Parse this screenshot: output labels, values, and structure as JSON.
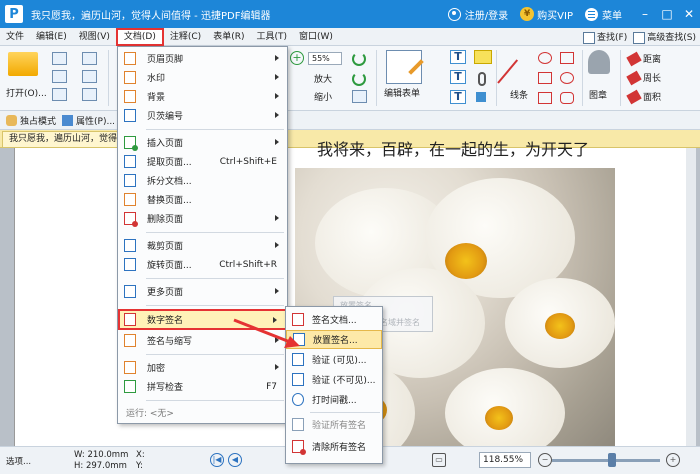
{
  "titlebar": {
    "title": "我只愿我，遍历山河，觉得人间值得",
    "app_name": "迅捷PDF编辑器",
    "login_label": "注册/登录",
    "vip_label": "购买VIP",
    "menu_label": "菜单"
  },
  "menubar": {
    "items": [
      "文件",
      "编辑(E)",
      "视图(V)",
      "文档(D)",
      "注释(C)",
      "表单(R)",
      "工具(T)",
      "窗口(W)"
    ],
    "find_label": "查找(F)",
    "advanced_find_label": "高级查找(S)"
  },
  "ribbon": {
    "open_label": "打开(O)...",
    "zoom_value": "55%",
    "zoom_in_label": "放大",
    "zoom_out_label": "缩小",
    "edit_form_label": "编辑表单",
    "line_label": "线条",
    "stamp_label": "图章",
    "measure_distance": "距离",
    "measure_perimeter": "周长",
    "measure_area": "面积"
  },
  "toolbar2": {
    "exclusive_mode": "独占模式",
    "properties": "属性(P)..."
  },
  "tab": {
    "doc_tab_label": "我只愿我，遍历山河，觉得人"
  },
  "document": {
    "visible_text": "我将来，百辟，在一起的生，为开天了"
  },
  "doc_menu": {
    "items": [
      {
        "label": "页眉页脚",
        "submenu": true
      },
      {
        "label": "水印",
        "submenu": true
      },
      {
        "label": "背景",
        "submenu": true
      },
      {
        "label": "贝茨编号",
        "submenu": true
      },
      {
        "label": "插入页面",
        "submenu": true
      },
      {
        "label": "提取页面...",
        "shortcut": "Ctrl+Shift+E"
      },
      {
        "label": "拆分文档..."
      },
      {
        "label": "替换页面..."
      },
      {
        "label": "删除页面",
        "submenu": true
      },
      {
        "label": "裁剪页面",
        "submenu": true
      },
      {
        "label": "旋转页面...",
        "shortcut": "Ctrl+Shift+R"
      },
      {
        "label": "更多页面",
        "submenu": true
      },
      {
        "label": "数字签名",
        "submenu": true
      },
      {
        "label": "签名与缩写",
        "submenu": true
      },
      {
        "label": "加密",
        "submenu": true
      },
      {
        "label": "拼写检查",
        "shortcut": "F7"
      },
      {
        "label": "运行: <无>"
      }
    ]
  },
  "sign_submenu": {
    "items": [
      {
        "label": "签名文档..."
      },
      {
        "label": "放置签名..."
      },
      {
        "label": "验证 (可见)..."
      },
      {
        "label": "验证 (不可见)..."
      },
      {
        "label": "打时间戳..."
      },
      {
        "label": "验证所有签名"
      },
      {
        "label": "清除所有签名"
      }
    ],
    "tooltip_title": "放置签名",
    "tooltip_text": "放置新的签名域并签名"
  },
  "statusbar": {
    "select_label": "选项...",
    "width": "W: 210.0mm",
    "height": "H: 297.0mm",
    "x_label": "X:",
    "y_label": "Y:",
    "zoom": "118.55%"
  },
  "colors": {
    "titlebar": "#1d86d8",
    "highlight_border": "#e53333",
    "menu_highlight": "#fff2b8"
  }
}
